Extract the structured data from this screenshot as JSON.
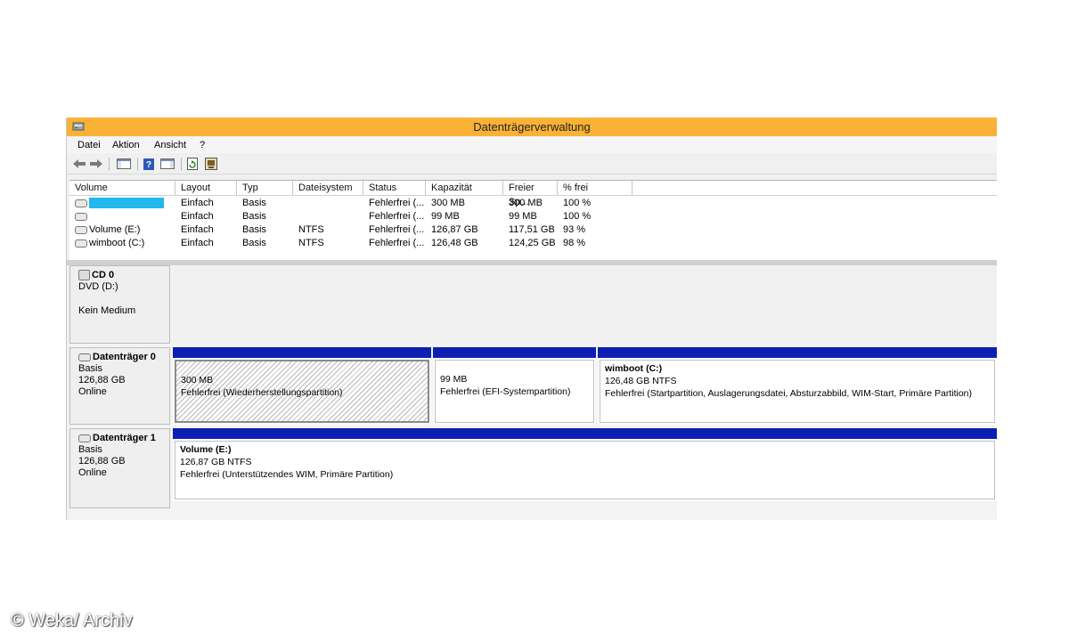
{
  "window": {
    "title": "Datenträgerverwaltung",
    "accent": "#f9b236"
  },
  "menu": [
    "Datei",
    "Aktion",
    "Ansicht",
    "?"
  ],
  "toolbar": {
    "icons": [
      "back-arrow-icon",
      "forward-arrow-icon",
      "console-tree-icon",
      "help-icon",
      "properties-icon",
      "refresh-icon",
      "rescan-icon"
    ]
  },
  "volume_list": {
    "columns": [
      "Volume",
      "Layout",
      "Typ",
      "Dateisystem",
      "Status",
      "Kapazität",
      "Freier Sp...",
      "% frei"
    ],
    "rows": [
      {
        "volume": "",
        "layout": "Einfach",
        "typ": "Basis",
        "fs": "",
        "status": "Fehlerfrei (...",
        "kapazitaet": "300 MB",
        "frei": "300 MB",
        "prozent": "100 %"
      },
      {
        "volume": "",
        "layout": "Einfach",
        "typ": "Basis",
        "fs": "",
        "status": "Fehlerfrei (...",
        "kapazitaet": "99 MB",
        "frei": "99 MB",
        "prozent": "100 %"
      },
      {
        "volume": "Volume (E:)",
        "layout": "Einfach",
        "typ": "Basis",
        "fs": "NTFS",
        "status": "Fehlerfrei (...",
        "kapazitaet": "126,87 GB",
        "frei": "117,51 GB",
        "prozent": "93 %"
      },
      {
        "volume": "wimboot (C:)",
        "layout": "Einfach",
        "typ": "Basis",
        "fs": "NTFS",
        "status": "Fehlerfrei (...",
        "kapazitaet": "126,48 GB",
        "frei": "124,25 GB",
        "prozent": "98 %"
      }
    ]
  },
  "disks": {
    "cd0": {
      "name": "CD 0",
      "line1": "DVD (D:)",
      "line2": "Kein Medium"
    },
    "disk0": {
      "name": "Datenträger 0",
      "type": "Basis",
      "size": "126,88 GB",
      "status": "Online",
      "partitions": [
        {
          "title": "",
          "size": "300 MB",
          "status": "Fehlerfrei (Wiederherstellungspartition)"
        },
        {
          "title": "",
          "size": "99 MB",
          "status": "Fehlerfrei (EFI-Systempartition)"
        },
        {
          "title": "wimboot  (C:)",
          "size": "126,48 GB NTFS",
          "status": "Fehlerfrei (Startpartition, Auslagerungsdatei, Absturzabbild, WIM-Start, Primäre Partition)"
        }
      ]
    },
    "disk1": {
      "name": "Datenträger 1",
      "type": "Basis",
      "size": "126,88 GB",
      "status": "Online",
      "partitions": [
        {
          "title": "Volume  (E:)",
          "size": "126,87 GB NTFS",
          "status": "Fehlerfrei (Unterstützendes WIM, Primäre Partition)"
        }
      ]
    },
    "partition_bar_color": "#0d1fb3"
  },
  "watermark": "© Weka/ Archiv"
}
